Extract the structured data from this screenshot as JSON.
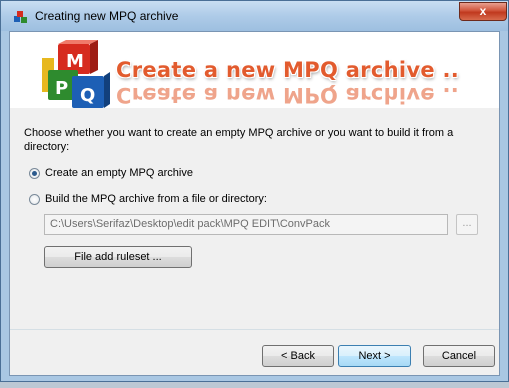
{
  "window": {
    "title": "Creating new MPQ archive",
    "close_label": "x"
  },
  "header": {
    "title": "Create a new MPQ archive ..",
    "logo_letters": [
      "M",
      "P",
      "Q"
    ],
    "logo_colors": [
      "#d62b1f",
      "#2e8b2e",
      "#1d5fb5",
      "#e7b81f"
    ]
  },
  "body": {
    "instructions": "Choose whether you want to create an empty MPQ archive or you want to build it from a directory:",
    "options": [
      {
        "label": "Create an empty MPQ archive",
        "selected": true
      },
      {
        "label": "Build the MPQ archive from a file or directory:",
        "selected": false
      }
    ],
    "path_value": "C:\\Users\\Serifaz\\Desktop\\edit pack\\MPQ EDIT\\ConvPack",
    "browse_label": "...",
    "ruleset_label": "File add ruleset ..."
  },
  "buttons": {
    "back": "< Back",
    "next": "Next >",
    "cancel": "Cancel"
  }
}
